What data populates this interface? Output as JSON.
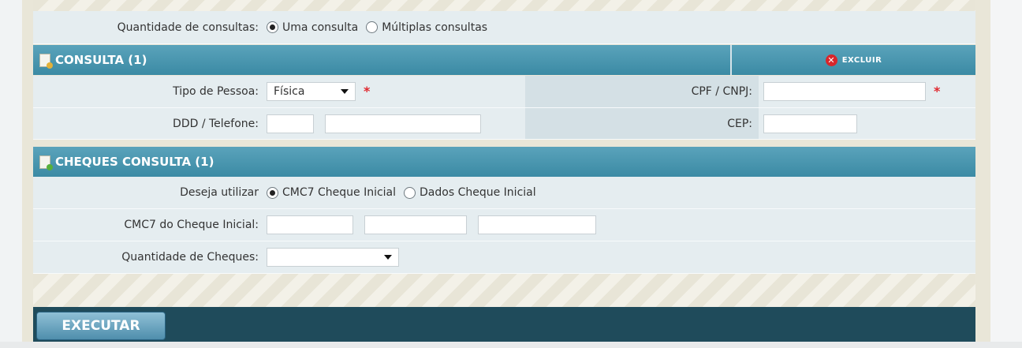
{
  "quantidade": {
    "label": "Quantidade de consultas:",
    "options": [
      {
        "label": "Uma consulta",
        "selected": true
      },
      {
        "label": "Múltiplas consultas",
        "selected": false
      }
    ]
  },
  "consulta": {
    "title": "CONSULTA (1)",
    "excluir_label": "EXCLUIR",
    "tipo_pessoa_label": "Tipo de Pessoa:",
    "tipo_pessoa_value": "Física",
    "cpf_label": "CPF / CNPJ:",
    "cpf_value": "",
    "ddd_label": "DDD / Telefone:",
    "ddd_value": "",
    "telefone_value": "",
    "cep_label": "CEP:",
    "cep_value": "",
    "required_mark": "*"
  },
  "cheques": {
    "title": "CHEQUES CONSULTA (1)",
    "deseja_label": "Deseja utilizar",
    "options": [
      {
        "label": "CMC7 Cheque Inicial",
        "selected": true
      },
      {
        "label": "Dados Cheque Inicial",
        "selected": false
      }
    ],
    "cmc7_label": "CMC7 do Cheque Inicial:",
    "cmc7_values": [
      "",
      "",
      ""
    ],
    "qtd_label": "Quantidade de Cheques:",
    "qtd_value": ""
  },
  "footer": {
    "executar_label": "EXECUTAR"
  },
  "colors": {
    "header_bar": "#3b8aa4",
    "footer_bar": "#1f4b5b",
    "required": "#e0282e",
    "excluir_icon": "#d8262b"
  }
}
